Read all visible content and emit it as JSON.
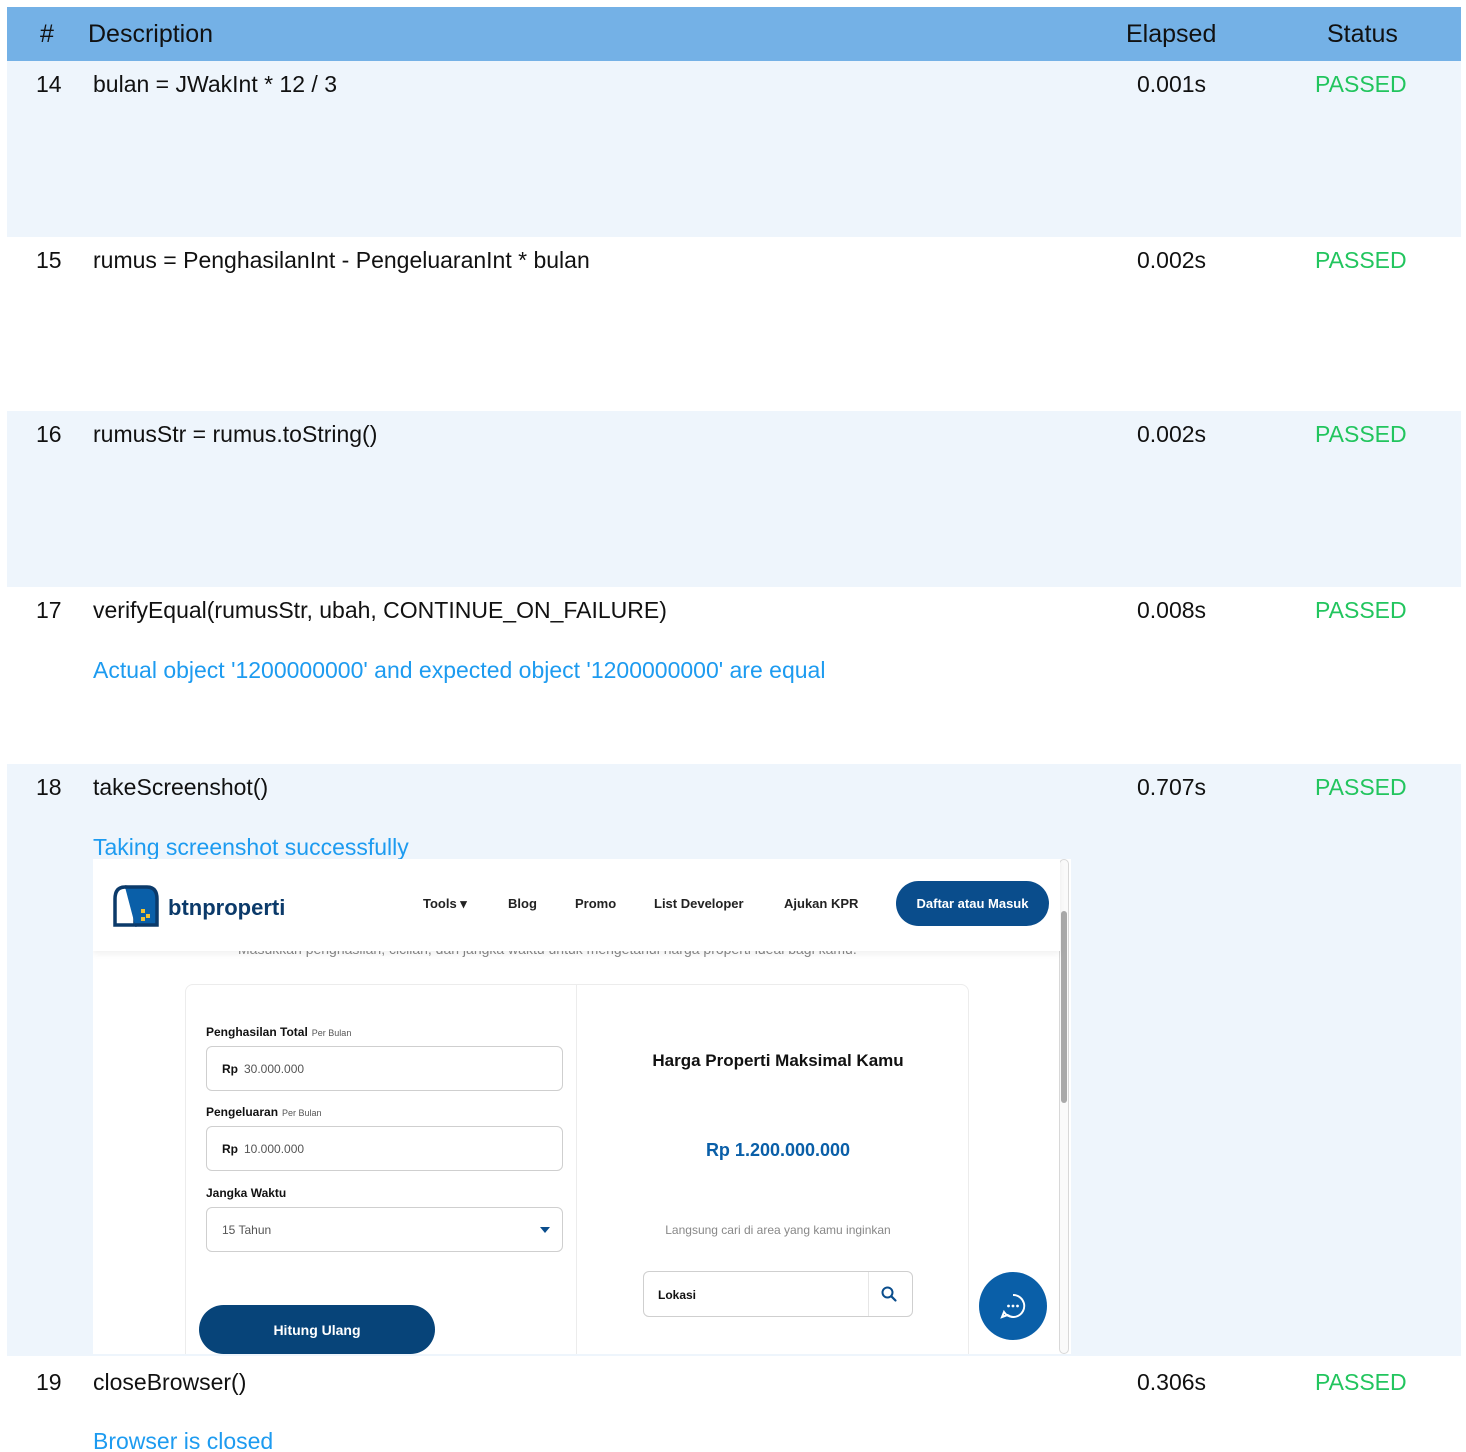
{
  "table": {
    "headers": {
      "num": "#",
      "description": "Description",
      "elapsed": "Elapsed",
      "status": "Status"
    },
    "rows": [
      {
        "num": "14",
        "description": "bulan = JWakInt * 12 / 3",
        "elapsed": "0.001s",
        "status": "PASSED",
        "message": ""
      },
      {
        "num": "15",
        "description": "rumus = PenghasilanInt - PengeluaranInt * bulan",
        "elapsed": "0.002s",
        "status": "PASSED",
        "message": ""
      },
      {
        "num": "16",
        "description": "rumusStr = rumus.toString()",
        "elapsed": "0.002s",
        "status": "PASSED",
        "message": ""
      },
      {
        "num": "17",
        "description": "verifyEqual(rumusStr, ubah, CONTINUE_ON_FAILURE)",
        "elapsed": "0.008s",
        "status": "PASSED",
        "message": "Actual object '1200000000' and expected object '1200000000' are equal"
      },
      {
        "num": "18",
        "description": "takeScreenshot()",
        "elapsed": "0.707s",
        "status": "PASSED",
        "message": "Taking screenshot successfully"
      },
      {
        "num": "19",
        "description": "closeBrowser()",
        "elapsed": "0.306s",
        "status": "PASSED",
        "message": "Browser is closed"
      }
    ]
  },
  "screenshot": {
    "brand": "btnproperti",
    "nav": {
      "tools": "Tools ▾",
      "blog": "Blog",
      "promo": "Promo",
      "list_developer": "List Developer",
      "ajukan_kpr": "Ajukan KPR",
      "login": "Daftar atau Masuk"
    },
    "subtitle": "Masukkan penghasilan, cicilan, dan jangka waktu untuk mengetahui harga properti ideal bagi kamu.",
    "form": {
      "income_label": "Penghasilan Total",
      "income_sub": "Per Bulan",
      "income_prefix": "Rp",
      "income_value": "30.000.000",
      "expense_label": "Pengeluaran",
      "expense_sub": "Per Bulan",
      "expense_prefix": "Rp",
      "expense_value": "10.000.000",
      "term_label": "Jangka Waktu",
      "term_value": "15 Tahun",
      "recalc_button": "Hitung Ulang"
    },
    "result": {
      "title": "Harga Properti Maksimal Kamu",
      "value": "Rp 1.200.000.000",
      "hint": "Langsung cari di area yang kamu inginkan",
      "location_placeholder": "Lokasi"
    },
    "colors": {
      "primary": "#0a4d8c",
      "accent": "#0a5fa8"
    }
  },
  "colors": {
    "header": "#74b1e6",
    "row_alt": "#eef5fc",
    "passed": "#22c55e",
    "message": "#1d9bf0"
  }
}
